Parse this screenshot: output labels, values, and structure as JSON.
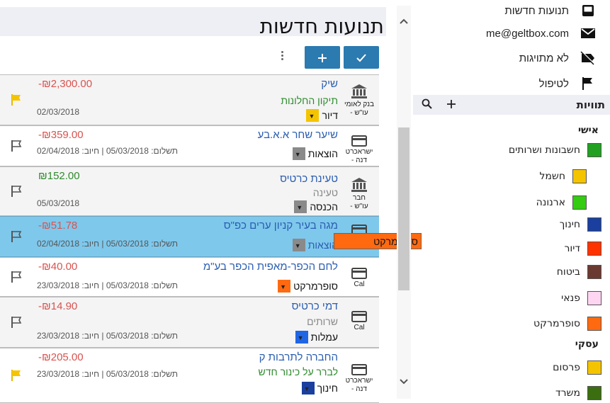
{
  "header": {
    "title": "תנועות חדשות",
    "add_label": "+",
    "confirm_label": "✓"
  },
  "transactions": [
    {
      "amount": "-₪2,300.00",
      "amount_color": "#d9534f",
      "desc": "שיק",
      "note": "תיקון החלונות",
      "note_color": "#2e8b2e",
      "date": "02/03/2018",
      "category": "דיור",
      "cat_color": "#f5c400",
      "account_line1": "בנק לאומי",
      "account_line2": "- עו\"ש",
      "account_icon": "bank-icon",
      "flagged": true
    },
    {
      "amount": "-₪359.00",
      "amount_color": "#d9534f",
      "desc": "שיער שחר א.א.בע",
      "note": "",
      "note_color": "",
      "date": "תשלום: 05/03/2018 | חיוב: 02/04/2018",
      "category": "הוצאות",
      "cat_color": "#8a8a8a",
      "account_line1": "ישראכרט",
      "account_line2": "- דנה",
      "account_icon": "credit-card-icon",
      "flagged": false
    },
    {
      "amount": "₪152.00",
      "amount_color": "#2e8b2e",
      "desc": "טעינת כרטיס",
      "note": "טעינה",
      "note_color": "#888888",
      "date": "05/03/2018",
      "category": "הכנסה",
      "cat_color": "#8a8a8a",
      "account_line1": "חבר",
      "account_line2": "- עו\"ש",
      "account_icon": "bank-icon",
      "flagged": false
    },
    {
      "amount": "-₪51.78",
      "amount_color": "#d9534f",
      "desc": "מגה בעיר קניון ערים כפ\"ס",
      "note": "",
      "note_color": "",
      "date": "תשלום: 05/03/2018 | חיוב: 02/04/2018",
      "category": "הוצאות",
      "cat_color": "#8a8a8a",
      "account_line1": "",
      "account_line2": "",
      "account_icon": "credit-card-icon",
      "flagged": false
    },
    {
      "amount": "-₪40.00",
      "amount_color": "#d9534f",
      "desc": "לחם הכפר-מאפית הכפר בע\"מ",
      "note": "",
      "note_color": "",
      "date": "תשלום: 05/03/2018 | חיוב: 23/03/2018",
      "category": "סופרמרקט",
      "cat_color": "#ff6a10",
      "account_line1": "Cal",
      "account_line2": "",
      "account_icon": "credit-card-icon",
      "flagged": false
    },
    {
      "amount": "-₪14.90",
      "amount_color": "#d9534f",
      "desc": "דמי כרטיס",
      "note": "שרותים",
      "note_color": "#888888",
      "date": "תשלום: 05/03/2018 | חיוב: 23/03/2018",
      "category": "עמלות",
      "cat_color": "#1f66e6",
      "account_line1": "Cal",
      "account_line2": "",
      "account_icon": "credit-card-icon",
      "flagged": false
    },
    {
      "amount": "-₪205.00",
      "amount_color": "#d9534f",
      "desc": "החברה לתרבות ק",
      "note": "לברר על כינור חדש",
      "note_color": "#2e8b2e",
      "date": "תשלום: 05/03/2018 | חיוב: 23/03/2018",
      "category": "חינוך",
      "cat_color": "#1a3f9e",
      "account_line1": "ישראכרט",
      "account_line2": "- דנה",
      "account_icon": "credit-card-icon",
      "flagged": true
    }
  ],
  "drag_tooltip": "סופרמרקט",
  "sidebar": {
    "nav": [
      {
        "label": "תנועות חדשות",
        "icon": "inbox-icon"
      },
      {
        "label": "me@geltbox.com",
        "icon": "envelope-icon"
      },
      {
        "label": "לא מתויגות",
        "icon": "untagged-icon"
      },
      {
        "label": "לטיפול",
        "icon": "flag-icon"
      }
    ],
    "labels_title": "תוויות",
    "groups": {
      "personal": "אישי",
      "business": "עסקי"
    },
    "labels": [
      {
        "name": "חשבונות ושרותים",
        "color": "#22a022"
      },
      {
        "name": "חשמל",
        "color": "#f5c400"
      },
      {
        "name": "ארנונה",
        "color": "#33cc11"
      },
      {
        "name": "חינוך",
        "color": "#1a3f9e"
      },
      {
        "name": "דיור",
        "color": "#ff3300"
      },
      {
        "name": "ביטוח",
        "color": "#6a3a30"
      },
      {
        "name": "פנאי",
        "color": "#ffd6f2"
      },
      {
        "name": "סופרמרקט",
        "color": "#ff6a10"
      },
      {
        "name": "פרסום",
        "color": "#f5c400"
      },
      {
        "name": "משרד",
        "color": "#3a6e10"
      }
    ]
  }
}
